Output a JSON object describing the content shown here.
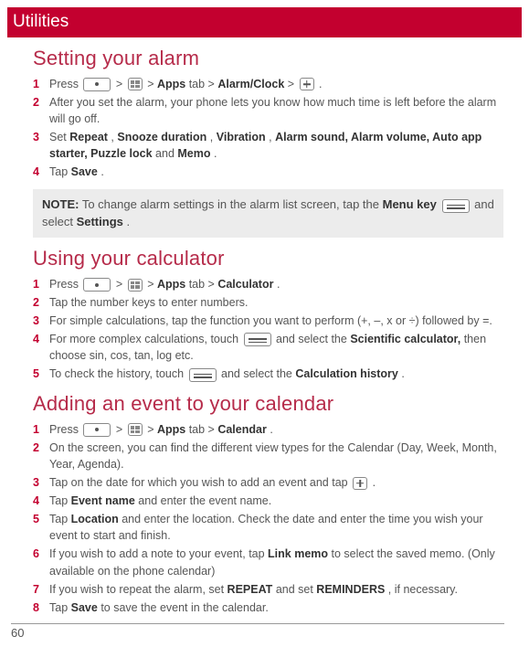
{
  "chapter_title": "Utilities",
  "page_number": "60",
  "sections": {
    "alarm": {
      "heading": "Setting your alarm",
      "s1a": "Press ",
      "s1b": " > ",
      "s1c": " > ",
      "s1_apps": "Apps",
      "s1_tab": " tab > ",
      "s1_alarmclock": "Alarm/Clock",
      "s1d": " > ",
      "s1e": ".",
      "s2": "After you set the alarm, your phone lets you know how much time is left before the alarm will go off.",
      "s3a": "Set ",
      "s3_repeat": "Repeat",
      "s3b": ", ",
      "s3_snooze": "Snooze duration",
      "s3c": ", ",
      "s3_vibration": "Vibration",
      "s3d": ", ",
      "s3_rest": "Alarm sound, Alarm volume, Auto app starter, Puzzle lock",
      "s3e": " and ",
      "s3_memo": "Memo",
      "s3f": ".",
      "s4a": "Tap ",
      "s4_save": "Save",
      "s4b": "."
    },
    "note": {
      "label": "NOTE:",
      "part1": " To change alarm settings in the alarm list screen, tap the ",
      "menukey": "Menu key",
      "part2": " and select ",
      "settings": "Settings",
      "part3": "."
    },
    "calc": {
      "heading": "Using your calculator",
      "s1a": "Press ",
      "s1b": " > ",
      "s1c": " > ",
      "s1_apps": "Apps",
      "s1_tab": " tab > ",
      "s1_calculator": "Calculator",
      "s1d": ".",
      "s2": "Tap the number keys to enter numbers.",
      "s3": "For simple calculations, tap the function you want to perform (+, –, x or ÷) followed by =.",
      "s4a": "For more complex calculations, touch ",
      "s4b": " and select the ",
      "s4_sci": "Scientific calculator,",
      "s4c": " then choose sin, cos, tan, log etc.",
      "s5a": "To check the history, touch ",
      "s5b": " and select the ",
      "s5_hist": "Calculation history",
      "s5c": "."
    },
    "cal": {
      "heading": "Adding an event to your calendar",
      "s1a": "Press ",
      "s1b": " > ",
      "s1c": " > ",
      "s1_apps": "Apps",
      "s1_tab": " tab > ",
      "s1_calendar": "Calendar",
      "s1d": ".",
      "s2": "On the screen, you can find the different view types for the Calendar (Day, Week, Month, Year, Agenda).",
      "s3a": "Tap on the date for which you wish to add an event and tap ",
      "s3b": ".",
      "s4a": "Tap ",
      "s4_eventname": "Event name",
      "s4b": " and enter the event name.",
      "s5a": "Tap ",
      "s5_location": "Location",
      "s5b": " and enter the location. Check the date and enter the time you wish your event to start and finish.",
      "s6a": "If you wish to add a note to your event, tap ",
      "s6_linkmemo": "Link memo",
      "s6b": " to select the saved memo. (Only available on the phone calendar)",
      "s7a": "If you wish to repeat the alarm, set ",
      "s7_repeat": "REPEAT",
      "s7b": " and set ",
      "s7_reminders": "REMINDERS",
      "s7c": ", if necessary.",
      "s8a": "Tap ",
      "s8_save": "Save",
      "s8b": " to save the event in the calendar."
    }
  }
}
